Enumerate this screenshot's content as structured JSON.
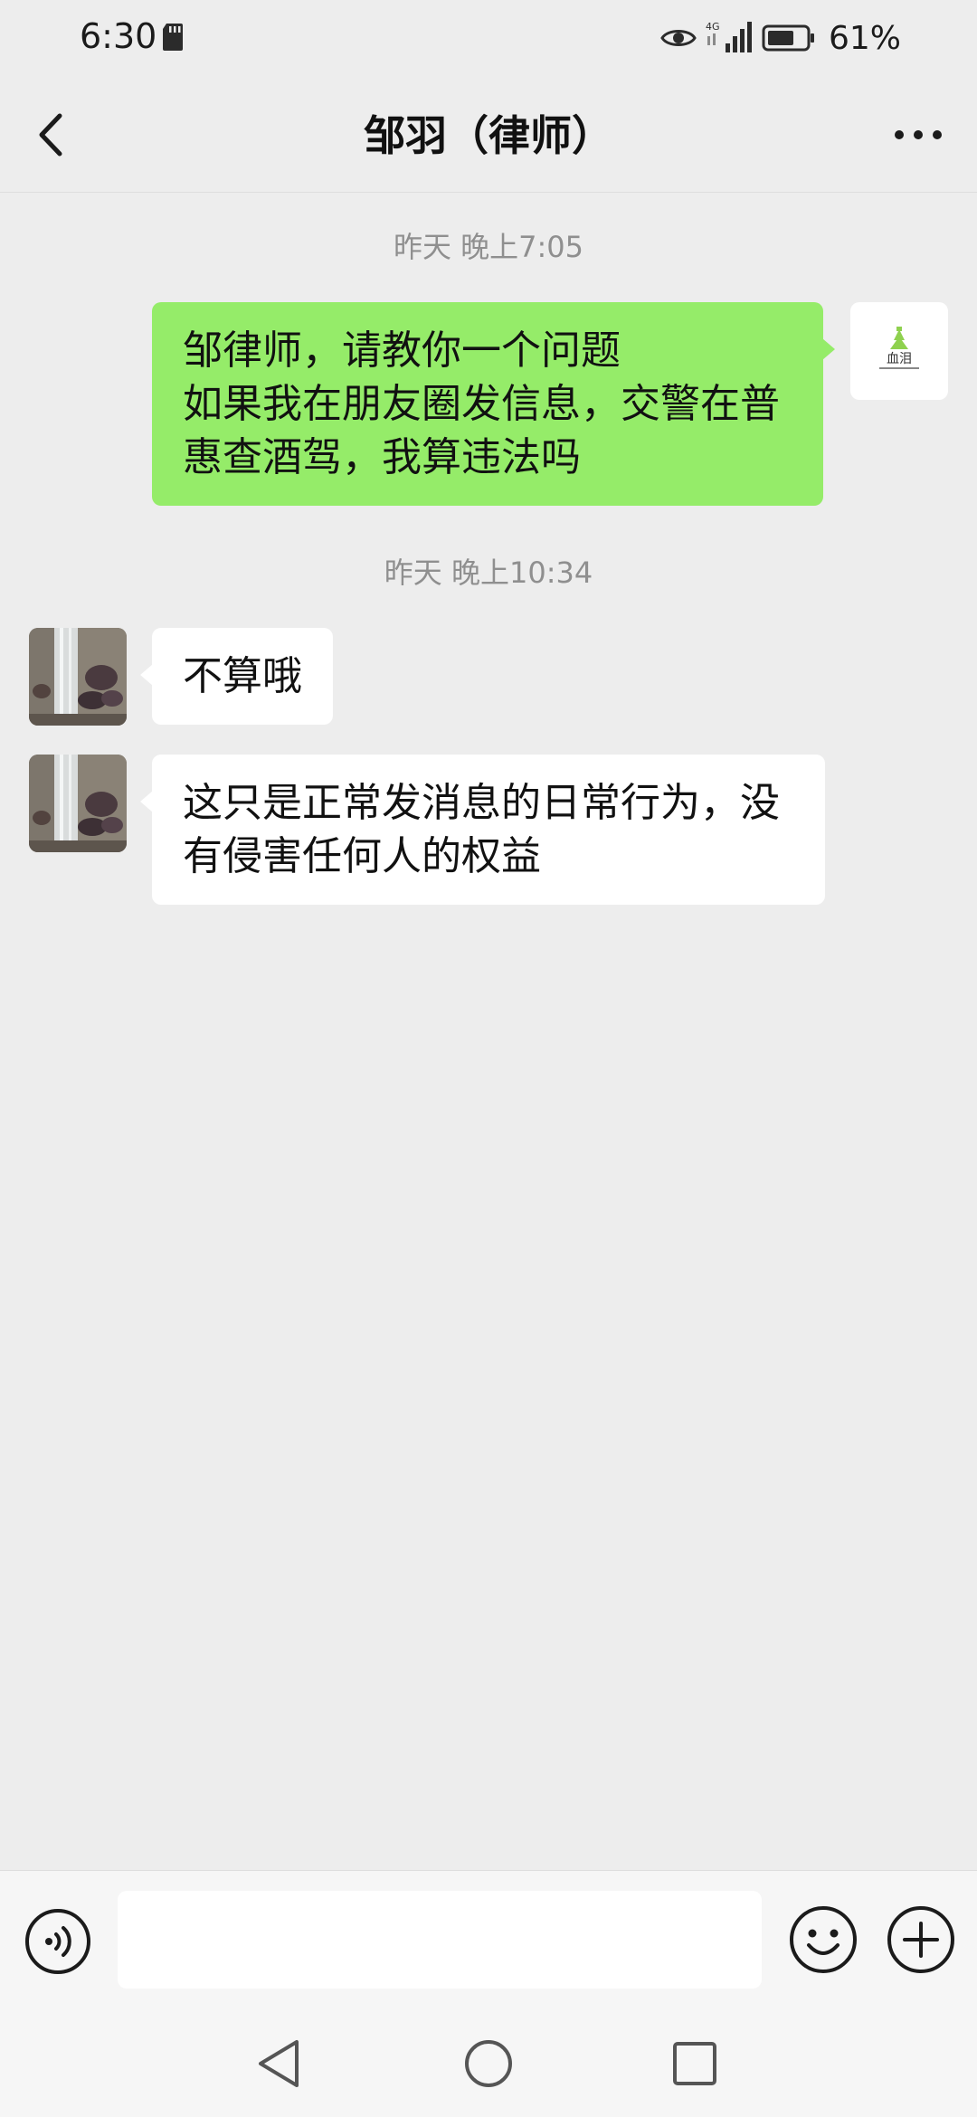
{
  "status_bar": {
    "time": "6:30",
    "network": "4G",
    "battery_percent": "61%"
  },
  "header": {
    "title": "邹羽（律师）"
  },
  "messages": [
    {
      "type": "timestamp",
      "text": "昨天 晚上7:05"
    },
    {
      "type": "outgoing",
      "lines": [
        "邹律师，请教你一个问题",
        "如果我在朋友圈发信息，交警在普",
        "惠查酒驾，我算违法吗"
      ]
    },
    {
      "type": "timestamp",
      "text": "昨天 晚上10:34"
    },
    {
      "type": "incoming",
      "lines": [
        "不算哦"
      ]
    },
    {
      "type": "incoming",
      "lines": [
        "这只是正常发消息的日常行为，没",
        "有侵害任何人的权益"
      ]
    }
  ],
  "self_avatar": {
    "logo_text": "血泪"
  },
  "input": {
    "value": "",
    "placeholder": ""
  },
  "icons": {
    "back": "chevron-left-icon",
    "more": "more-dots-icon",
    "voice": "voice-icon",
    "emoji": "emoji-icon",
    "plus": "plus-icon",
    "nav_back": "nav-back-icon",
    "nav_home": "nav-home-icon",
    "nav_recents": "nav-recents-icon"
  },
  "colors": {
    "background": "#ededed",
    "outgoing_bubble": "#95ec69",
    "incoming_bubble": "#ffffff"
  }
}
